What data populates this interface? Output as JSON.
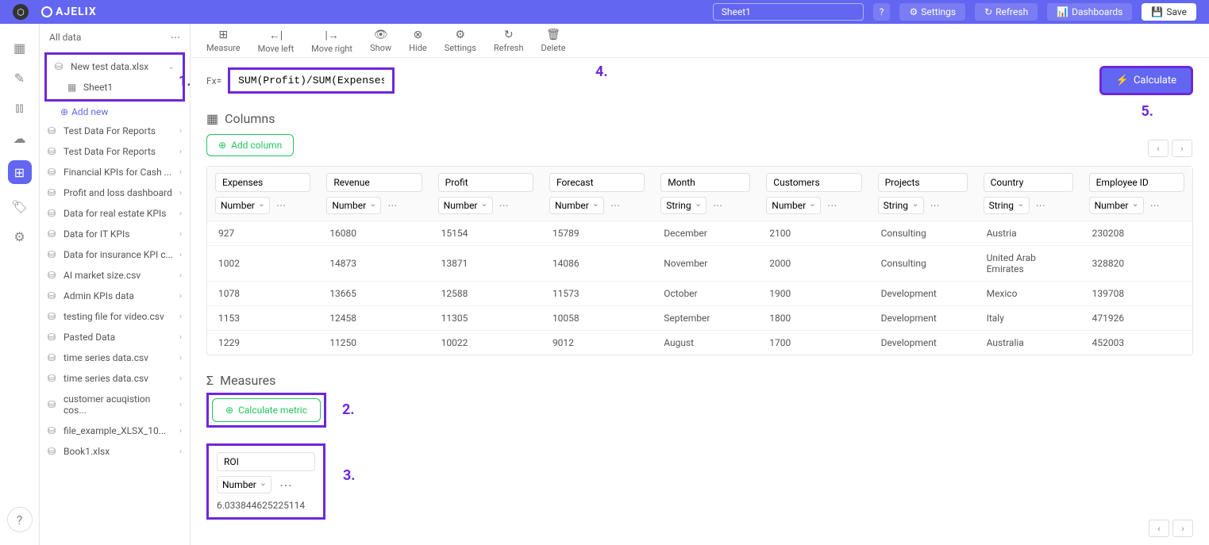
{
  "topbar": {
    "brand": "AJELIX",
    "sheet_input": "Sheet1",
    "help": "?",
    "settings": "Settings",
    "refresh": "Refresh",
    "dashboards": "Dashboards",
    "save": "Save"
  },
  "sidebar": {
    "title": "All data",
    "current_file": "New test data.xlsx",
    "current_sheet": "Sheet1",
    "add_new": "Add new",
    "items": [
      "Test Data For Reports",
      "Test Data For Reports",
      "Financial KPIs for Cash ...",
      "Profit and loss dashboard",
      "Data for real estate KPIs",
      "Data for IT KPIs",
      "Data for insurance KPI c...",
      "AI market size.csv",
      "Admin KPIs data",
      "testing file for video.csv",
      "Pasted Data",
      "time series data.csv",
      "time series data.csv",
      "customer acuqistion cos...",
      "file_example_XLSX_10...",
      "Book1.xlsx"
    ]
  },
  "toolbar": {
    "measure": "Measure",
    "move_left": "Move left",
    "move_right": "Move right",
    "show": "Show",
    "hide": "Hide",
    "settings": "Settings",
    "refresh": "Refresh",
    "delete": "Delete"
  },
  "formula": {
    "label": "Fx=",
    "value": "SUM(Profit)/SUM(Expenses)",
    "calculate": "Calculate"
  },
  "columns_section": {
    "title": "Columns",
    "add_column": "Add column"
  },
  "table": {
    "columns": [
      {
        "name": "Expenses",
        "type": "Number"
      },
      {
        "name": "Revenue",
        "type": "Number"
      },
      {
        "name": "Profit",
        "type": "Number"
      },
      {
        "name": "Forecast",
        "type": "Number"
      },
      {
        "name": "Month",
        "type": "String"
      },
      {
        "name": "Customers",
        "type": "Number"
      },
      {
        "name": "Projects",
        "type": "String"
      },
      {
        "name": "Country",
        "type": "String"
      },
      {
        "name": "Employee ID",
        "type": "Number"
      }
    ],
    "rows": [
      [
        "927",
        "16080",
        "15154",
        "15789",
        "December",
        "2100",
        "Consulting",
        "Austria",
        "230208"
      ],
      [
        "1002",
        "14873",
        "13871",
        "14086",
        "November",
        "2000",
        "Consulting",
        "United Arab Emirates",
        "328820"
      ],
      [
        "1078",
        "13665",
        "12588",
        "11573",
        "October",
        "1900",
        "Development",
        "Mexico",
        "139708"
      ],
      [
        "1153",
        "12458",
        "11305",
        "10058",
        "September",
        "1800",
        "Development",
        "Italy",
        "471926"
      ],
      [
        "1229",
        "11250",
        "10022",
        "9012",
        "August",
        "1700",
        "Development",
        "Australia",
        "452003"
      ]
    ]
  },
  "measures_section": {
    "title": "Measures",
    "calculate_metric": "Calculate metric",
    "measure_name": "ROI",
    "measure_type": "Number",
    "measure_value": "6.033844625225114"
  },
  "annotations": {
    "a1": "1.",
    "a2": "2.",
    "a3": "3.",
    "a4": "4.",
    "a5": "5."
  }
}
